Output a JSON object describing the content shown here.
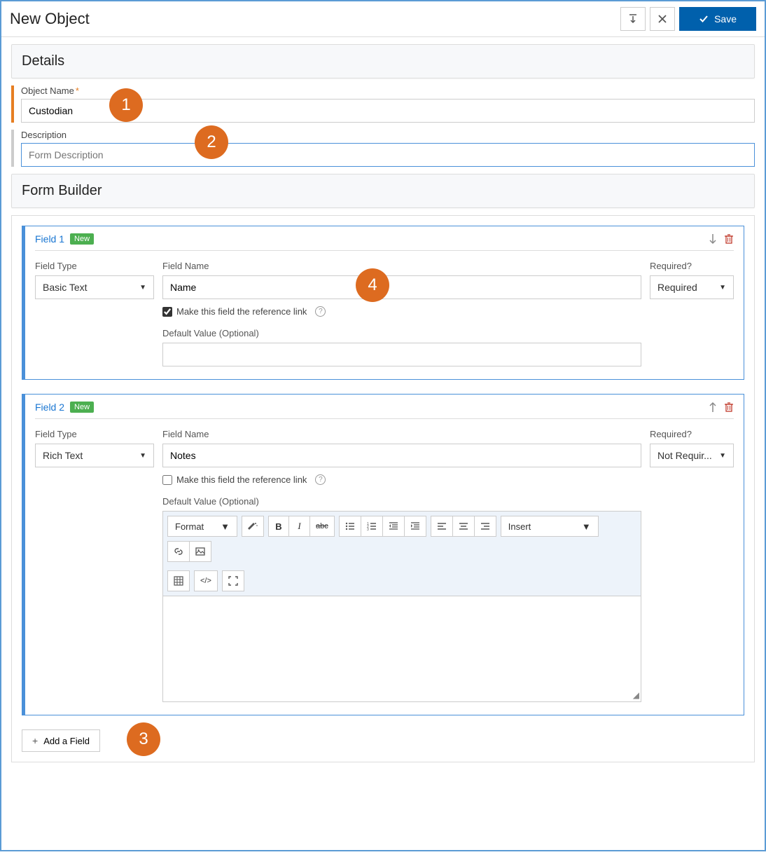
{
  "header": {
    "title": "New Object",
    "save_label": "Save"
  },
  "sections": {
    "details": "Details",
    "form_builder": "Form Builder"
  },
  "details": {
    "object_name_label": "Object Name",
    "object_name_value": "Custodian",
    "description_label": "Description",
    "description_placeholder": "Form Description"
  },
  "callouts": {
    "c1": "1",
    "c2": "2",
    "c3": "3",
    "c4": "4"
  },
  "fields": [
    {
      "title": "Field 1",
      "badge": "New",
      "type_label": "Field Type",
      "type_value": "Basic Text",
      "name_label": "Field Name",
      "name_value": "Name",
      "required_label": "Required?",
      "required_value": "Required",
      "reference_checked": true,
      "reference_label": "Make this field the reference link",
      "default_label": "Default Value (Optional)"
    },
    {
      "title": "Field 2",
      "badge": "New",
      "type_label": "Field Type",
      "type_value": "Rich Text",
      "name_label": "Field Name",
      "name_value": "Notes",
      "required_label": "Required?",
      "required_value": "Not Requir...",
      "reference_checked": false,
      "reference_label": "Make this field the reference link",
      "default_label": "Default Value (Optional)"
    }
  ],
  "editor": {
    "format_label": "Format",
    "insert_label": "Insert"
  },
  "add_field_label": "Add a Field"
}
